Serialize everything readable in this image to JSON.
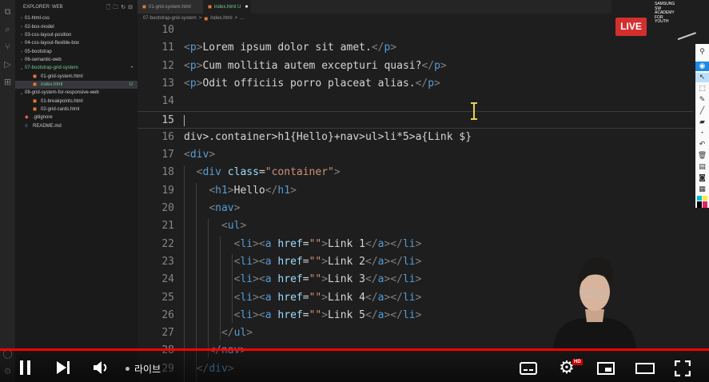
{
  "explorer": {
    "header": "EXPLORER: WEB",
    "items": [
      {
        "label": "01-html-css",
        "kind": "folder",
        "open": false,
        "depth": 0
      },
      {
        "label": "02-box-model",
        "kind": "folder",
        "open": false,
        "depth": 0
      },
      {
        "label": "03-css-layout-position",
        "kind": "folder",
        "open": false,
        "depth": 0
      },
      {
        "label": "04-css-layout-flexible-box",
        "kind": "folder",
        "open": false,
        "depth": 0
      },
      {
        "label": "05-bootstrap",
        "kind": "folder",
        "open": false,
        "depth": 0
      },
      {
        "label": "06-semantic-web",
        "kind": "folder",
        "open": false,
        "depth": 0
      },
      {
        "label": "07-bootstrap-grid-system",
        "kind": "folder",
        "open": true,
        "depth": 0,
        "color": "#73c991",
        "badge": "•"
      },
      {
        "label": "01-grid-system.html",
        "kind": "html",
        "depth": 1
      },
      {
        "label": "index.html",
        "kind": "html",
        "depth": 1,
        "color": "#73c991",
        "badge": "U",
        "selected": true
      },
      {
        "label": "08-grid-system-for-responsive-web",
        "kind": "folder",
        "open": true,
        "depth": 0
      },
      {
        "label": "01-breakpoints.html",
        "kind": "html",
        "depth": 1
      },
      {
        "label": "02-grid-cards.html",
        "kind": "html",
        "depth": 1
      },
      {
        "label": ".gitignore",
        "kind": "git",
        "depth": 0
      },
      {
        "label": "README.md",
        "kind": "md",
        "depth": 0
      }
    ]
  },
  "tabs": [
    {
      "label": "01-grid-system.html",
      "active": false
    },
    {
      "label": "index.html U",
      "active": true
    }
  ],
  "breadcrumb": [
    "07-bootstrap-grid-system",
    ">",
    "index.html",
    ">",
    "..."
  ],
  "editor": {
    "lines": [
      {
        "n": "10",
        "tokens": []
      },
      {
        "n": "11",
        "tokens": [
          [
            "t-punc",
            "<"
          ],
          [
            "t-tag",
            "p"
          ],
          [
            "t-punc",
            ">"
          ],
          [
            "t-text",
            "Lorem ipsum dolor sit amet."
          ],
          [
            "t-punc",
            "</"
          ],
          [
            "t-tag",
            "p"
          ],
          [
            "t-punc",
            ">"
          ]
        ]
      },
      {
        "n": "12",
        "tokens": [
          [
            "t-punc",
            "<"
          ],
          [
            "t-tag",
            "p"
          ],
          [
            "t-punc",
            ">"
          ],
          [
            "t-text",
            "Cum mollitia autem excepturi quasi?"
          ],
          [
            "t-punc",
            "</"
          ],
          [
            "t-tag",
            "p"
          ],
          [
            "t-punc",
            ">"
          ]
        ]
      },
      {
        "n": "13",
        "tokens": [
          [
            "t-punc",
            "<"
          ],
          [
            "t-tag",
            "p"
          ],
          [
            "t-punc",
            ">"
          ],
          [
            "t-text",
            "Odit officiis porro placeat alias."
          ],
          [
            "t-punc",
            "</"
          ],
          [
            "t-tag",
            "p"
          ],
          [
            "t-punc",
            ">"
          ]
        ]
      },
      {
        "n": "14",
        "tokens": []
      },
      {
        "n": "15",
        "tokens": [],
        "current": true
      },
      {
        "n": "16",
        "tokens": [
          [
            "t-text",
            "div>.container>h1{Hello}+nav>ul>li*5>a{Link $}"
          ]
        ]
      },
      {
        "n": "17",
        "tokens": [
          [
            "t-punc",
            "<"
          ],
          [
            "t-tag",
            "div"
          ],
          [
            "t-punc",
            ">"
          ]
        ]
      },
      {
        "n": "18",
        "tokens": [
          [
            "t-text",
            "  "
          ],
          [
            "t-punc",
            "<"
          ],
          [
            "t-tag",
            "div"
          ],
          [
            "t-text",
            " "
          ],
          [
            "t-attr",
            "class"
          ],
          [
            "t-eq",
            "="
          ],
          [
            "t-str",
            "\"container\""
          ],
          [
            "t-punc",
            ">"
          ]
        ]
      },
      {
        "n": "19",
        "tokens": [
          [
            "t-text",
            "    "
          ],
          [
            "t-punc",
            "<"
          ],
          [
            "t-tag",
            "h1"
          ],
          [
            "t-punc",
            ">"
          ],
          [
            "t-text",
            "Hello"
          ],
          [
            "t-punc",
            "</"
          ],
          [
            "t-tag",
            "h1"
          ],
          [
            "t-punc",
            ">"
          ]
        ]
      },
      {
        "n": "20",
        "tokens": [
          [
            "t-text",
            "    "
          ],
          [
            "t-punc",
            "<"
          ],
          [
            "t-tag",
            "nav"
          ],
          [
            "t-punc",
            ">"
          ]
        ]
      },
      {
        "n": "21",
        "tokens": [
          [
            "t-text",
            "      "
          ],
          [
            "t-punc",
            "<"
          ],
          [
            "t-tag",
            "ul"
          ],
          [
            "t-punc",
            ">"
          ]
        ]
      },
      {
        "n": "22",
        "tokens": [
          [
            "t-text",
            "        "
          ],
          [
            "t-punc",
            "<"
          ],
          [
            "t-tag",
            "li"
          ],
          [
            "t-punc",
            "><"
          ],
          [
            "t-tag",
            "a"
          ],
          [
            "t-text",
            " "
          ],
          [
            "t-attr",
            "href"
          ],
          [
            "t-eq",
            "="
          ],
          [
            "t-str",
            "\"\""
          ],
          [
            "t-punc",
            ">"
          ],
          [
            "t-text",
            "Link 1"
          ],
          [
            "t-punc",
            "</"
          ],
          [
            "t-tag",
            "a"
          ],
          [
            "t-punc",
            "></"
          ],
          [
            "t-tag",
            "li"
          ],
          [
            "t-punc",
            ">"
          ]
        ]
      },
      {
        "n": "23",
        "tokens": [
          [
            "t-text",
            "        "
          ],
          [
            "t-punc",
            "<"
          ],
          [
            "t-tag",
            "li"
          ],
          [
            "t-punc",
            "><"
          ],
          [
            "t-tag",
            "a"
          ],
          [
            "t-text",
            " "
          ],
          [
            "t-attr",
            "href"
          ],
          [
            "t-eq",
            "="
          ],
          [
            "t-str",
            "\"\""
          ],
          [
            "t-punc",
            ">"
          ],
          [
            "t-text",
            "Link 2"
          ],
          [
            "t-punc",
            "</"
          ],
          [
            "t-tag",
            "a"
          ],
          [
            "t-punc",
            "></"
          ],
          [
            "t-tag",
            "li"
          ],
          [
            "t-punc",
            ">"
          ]
        ]
      },
      {
        "n": "24",
        "tokens": [
          [
            "t-text",
            "        "
          ],
          [
            "t-punc",
            "<"
          ],
          [
            "t-tag",
            "li"
          ],
          [
            "t-punc",
            "><"
          ],
          [
            "t-tag",
            "a"
          ],
          [
            "t-text",
            " "
          ],
          [
            "t-attr",
            "href"
          ],
          [
            "t-eq",
            "="
          ],
          [
            "t-str",
            "\"\""
          ],
          [
            "t-punc",
            ">"
          ],
          [
            "t-text",
            "Link 3"
          ],
          [
            "t-punc",
            "</"
          ],
          [
            "t-tag",
            "a"
          ],
          [
            "t-punc",
            "></"
          ],
          [
            "t-tag",
            "li"
          ],
          [
            "t-punc",
            ">"
          ]
        ]
      },
      {
        "n": "25",
        "tokens": [
          [
            "t-text",
            "        "
          ],
          [
            "t-punc",
            "<"
          ],
          [
            "t-tag",
            "li"
          ],
          [
            "t-punc",
            "><"
          ],
          [
            "t-tag",
            "a"
          ],
          [
            "t-text",
            " "
          ],
          [
            "t-attr",
            "href"
          ],
          [
            "t-eq",
            "="
          ],
          [
            "t-str",
            "\"\""
          ],
          [
            "t-punc",
            ">"
          ],
          [
            "t-text",
            "Link 4"
          ],
          [
            "t-punc",
            "</"
          ],
          [
            "t-tag",
            "a"
          ],
          [
            "t-punc",
            "></"
          ],
          [
            "t-tag",
            "li"
          ],
          [
            "t-punc",
            ">"
          ]
        ]
      },
      {
        "n": "26",
        "tokens": [
          [
            "t-text",
            "        "
          ],
          [
            "t-punc",
            "<"
          ],
          [
            "t-tag",
            "li"
          ],
          [
            "t-punc",
            "><"
          ],
          [
            "t-tag",
            "a"
          ],
          [
            "t-text",
            " "
          ],
          [
            "t-attr",
            "href"
          ],
          [
            "t-eq",
            "="
          ],
          [
            "t-str",
            "\"\""
          ],
          [
            "t-punc",
            ">"
          ],
          [
            "t-text",
            "Link 5"
          ],
          [
            "t-punc",
            "</"
          ],
          [
            "t-tag",
            "a"
          ],
          [
            "t-punc",
            "></"
          ],
          [
            "t-tag",
            "li"
          ],
          [
            "t-punc",
            ">"
          ]
        ]
      },
      {
        "n": "27",
        "tokens": [
          [
            "t-text",
            "      "
          ],
          [
            "t-punc",
            "</"
          ],
          [
            "t-tag",
            "ul"
          ],
          [
            "t-punc",
            ">"
          ]
        ]
      },
      {
        "n": "28",
        "tokens": [
          [
            "t-text",
            "    "
          ],
          [
            "t-punc",
            "</"
          ],
          [
            "t-tag",
            "nav"
          ],
          [
            "t-punc",
            ">"
          ]
        ]
      },
      {
        "n": "29",
        "tokens": [
          [
            "t-text",
            "  "
          ],
          [
            "t-punc",
            "</"
          ],
          [
            "t-tag",
            "div"
          ],
          [
            "t-punc",
            ">"
          ]
        ]
      }
    ]
  },
  "overlay": {
    "live_badge": "LIVE",
    "logo_lines": [
      "SAMSUNG",
      "SW",
      "ACADEMY",
      "FOR",
      "YOUTH"
    ]
  },
  "player": {
    "live_label": "라이브",
    "hd_badge": "HD",
    "progress_fraction": 1.0,
    "accent": "#ff0000"
  },
  "colors": {
    "tag": "#569cd6",
    "attr": "#9cdcfe",
    "string": "#ce9178",
    "untracked": "#73c991"
  }
}
